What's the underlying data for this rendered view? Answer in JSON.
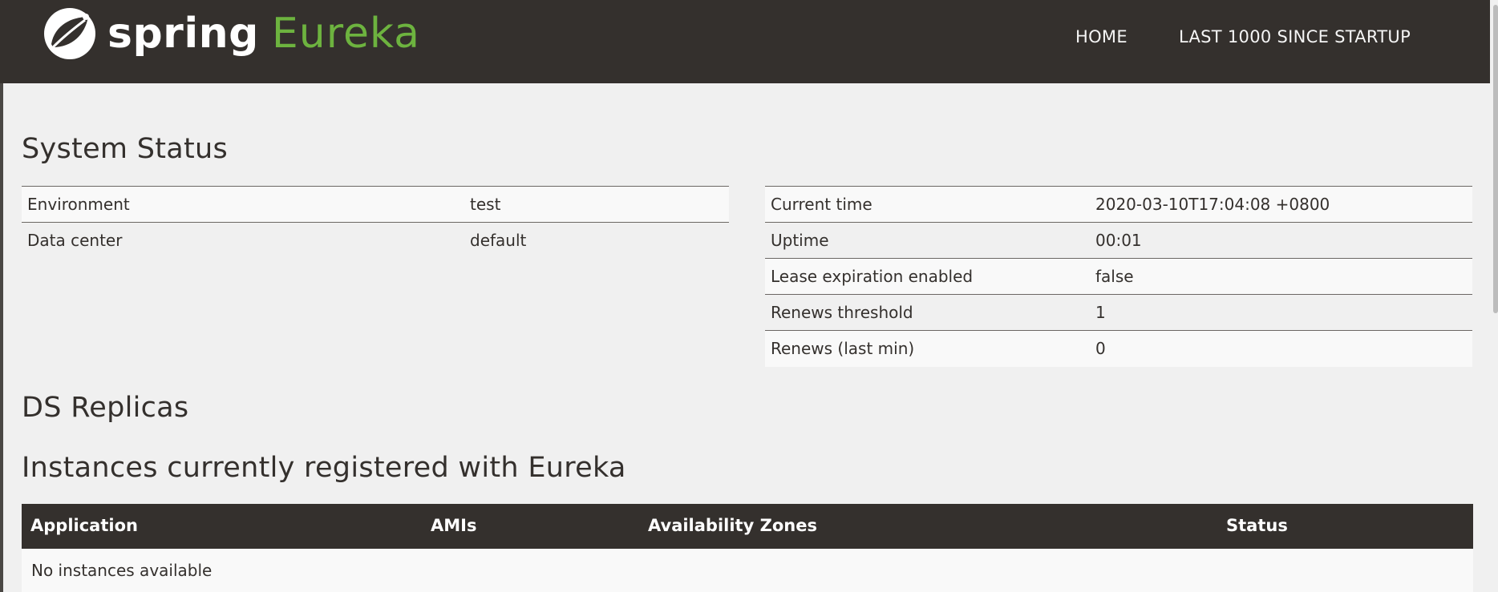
{
  "brand": {
    "logo_icon": "spring-leaf-icon",
    "name_part1": "spring",
    "name_part2": "Eureka",
    "accent_color": "#6db33f",
    "navbar_color": "#34302d"
  },
  "nav": {
    "home": "HOME",
    "last1000": "LAST 1000 SINCE STARTUP"
  },
  "system_status": {
    "title": "System Status",
    "left": [
      {
        "label": "Environment",
        "value": "test"
      },
      {
        "label": "Data center",
        "value": "default"
      }
    ],
    "right": [
      {
        "label": "Current time",
        "value": "2020-03-10T17:04:08 +0800"
      },
      {
        "label": "Uptime",
        "value": "00:01"
      },
      {
        "label": "Lease expiration enabled",
        "value": "false"
      },
      {
        "label": "Renews threshold",
        "value": "1"
      },
      {
        "label": "Renews (last min)",
        "value": "0"
      }
    ]
  },
  "ds_replicas": {
    "title": "DS Replicas"
  },
  "instances": {
    "title": "Instances currently registered with Eureka",
    "columns": [
      "Application",
      "AMIs",
      "Availability Zones",
      "Status"
    ],
    "empty_message": "No instances available"
  }
}
